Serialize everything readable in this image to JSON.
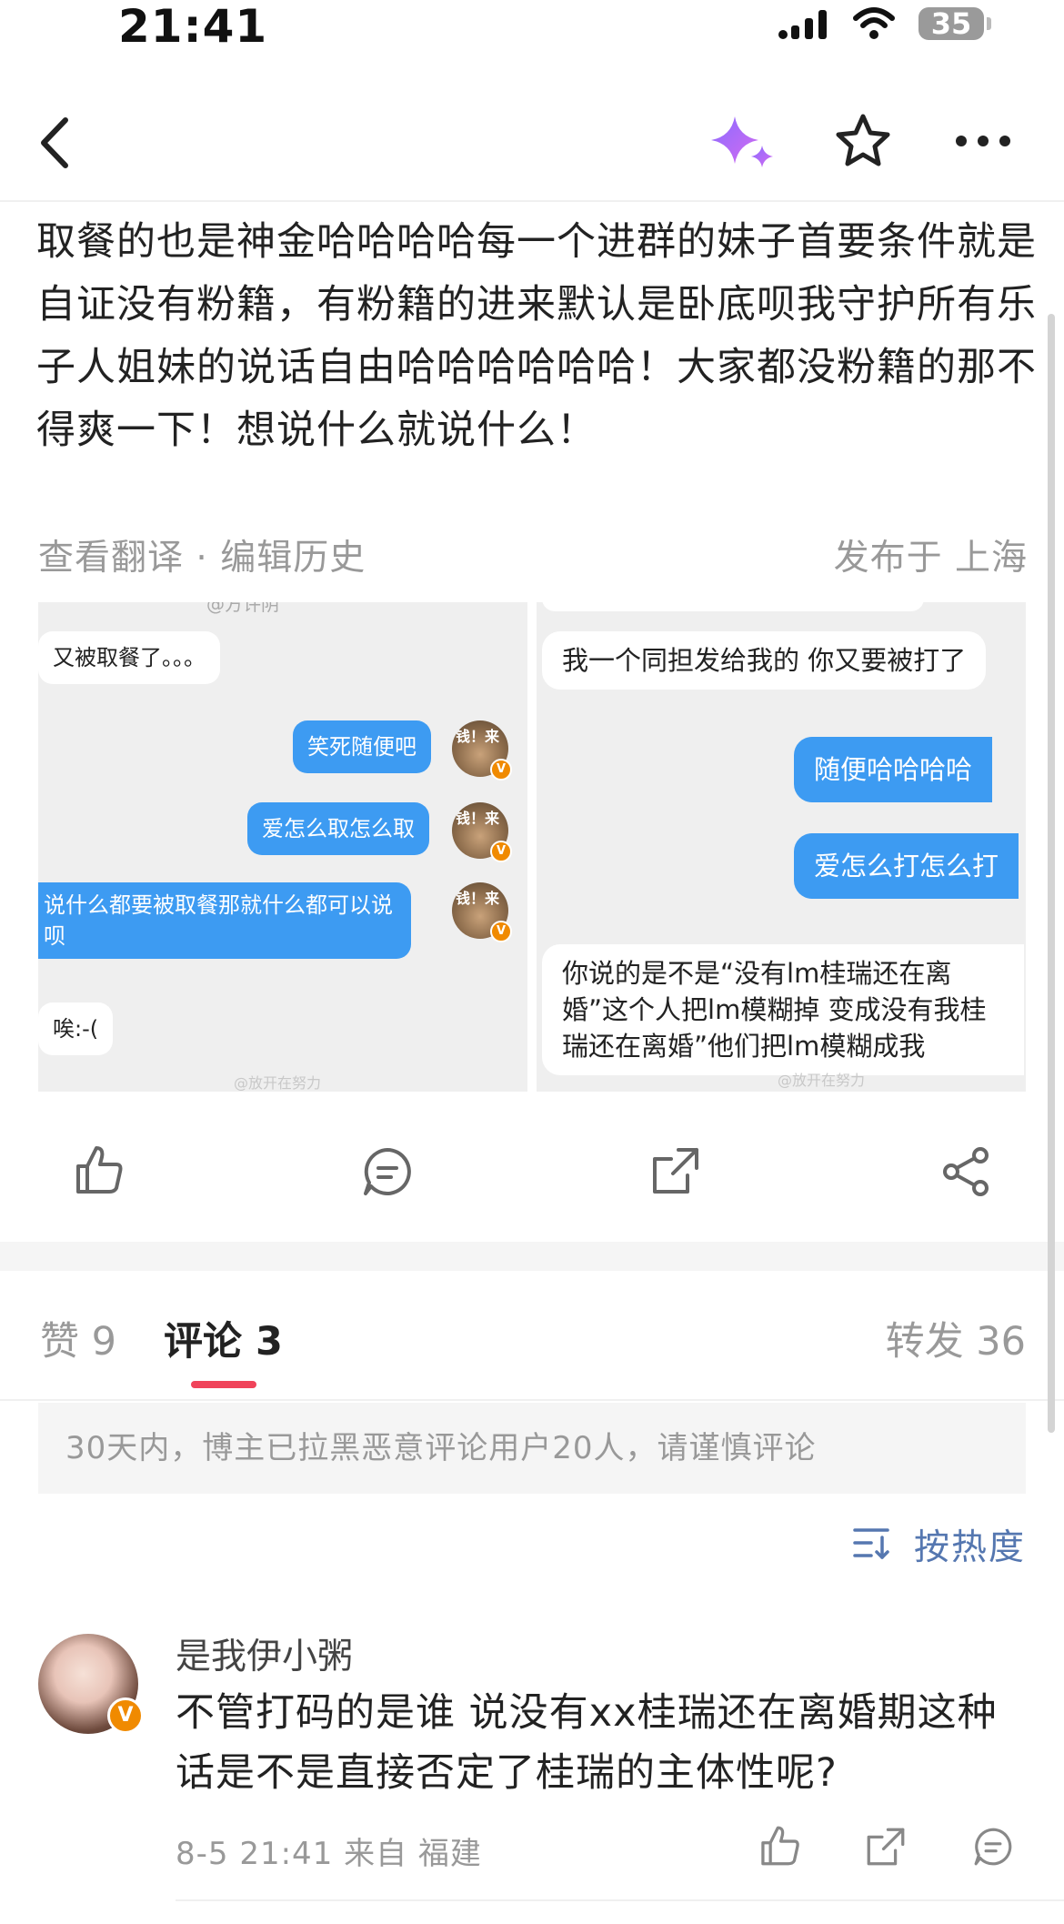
{
  "status_bar": {
    "time": "21:41",
    "battery": "35"
  },
  "post": {
    "text": "取餐的也是神金哈哈哈哈每一个进群的妹子首要条件就是自证没有粉籍，有粉籍的进来默认是卧底呗我守护所有乐子人姐妹的说话自由哈哈哈哈哈哈！大家都没粉籍的那不得爽一下！想说什么就说什么！",
    "meta_left": "查看翻译 · 编辑历史",
    "meta_right": "发布于 上海"
  },
  "image1": {
    "top_fragment": "@方许阴",
    "messages": [
      {
        "side": "left",
        "text": "又被取餐了。。。"
      },
      {
        "side": "right",
        "text": "笑死随便吧"
      },
      {
        "side": "right",
        "text": "爱怎么取怎么取"
      },
      {
        "side": "right",
        "text": "说什么都要被取餐那就什么都可以说呗"
      },
      {
        "side": "left",
        "text": "唉:-("
      }
    ],
    "avatar_label": "钱！来",
    "watermark": "@放开在努力"
  },
  "image2": {
    "messages": [
      {
        "side": "left",
        "text": "我一个同担发给我的 你又要被打了"
      },
      {
        "side": "right",
        "text": "随便哈哈哈哈"
      },
      {
        "side": "right",
        "text": "爱怎么打怎么打"
      },
      {
        "side": "left",
        "text": "你说的是不是“没有lm桂瑞还在离婚”这个人把lm模糊掉 变成没有我桂瑞还在离婚”他们把lm模糊成我"
      }
    ],
    "watermark": "@放开在努力"
  },
  "tabs": [
    {
      "label": "赞 9",
      "active": false
    },
    {
      "label": "评论 3",
      "active": true
    },
    {
      "label": "转发 36",
      "active": false
    }
  ],
  "notice": "30天内，博主已拉黑恶意评论用户20人，请谨慎评论",
  "sort_label": "按热度",
  "comment": {
    "username": "是我伊小粥",
    "text": "不管打码的是谁 说没有xx桂瑞还在离婚期这种话是不是直接否定了桂瑞的主体性呢?",
    "meta": "8-5 21:41   来自 福建"
  },
  "colors": {
    "accent": "#f0435a",
    "bubble_blue": "#3d9bf2",
    "link_blue": "#5577b0",
    "verified_orange": "#f08a00"
  }
}
